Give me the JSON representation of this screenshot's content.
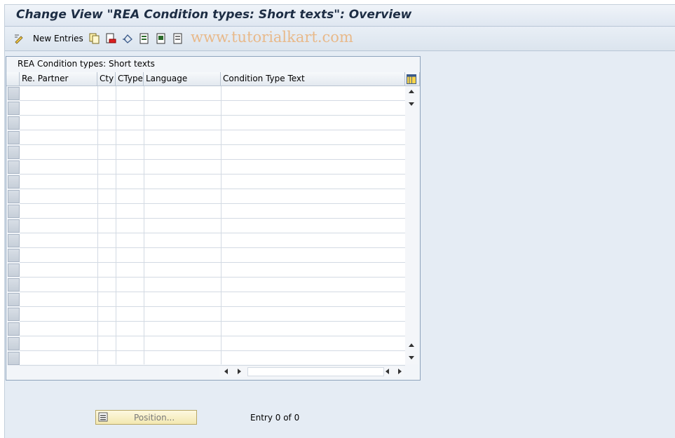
{
  "window": {
    "title": "Change View \"REA Condition types: Short texts\": Overview"
  },
  "toolbar": {
    "new_entries_label": "New Entries",
    "icons": [
      "edit-pencil-icon",
      "copy-icon",
      "delete-icon",
      "undo-icon",
      "select-all-icon",
      "select-block-icon",
      "deselect-all-icon"
    ],
    "watermark": "www.tutorialkart.com"
  },
  "table": {
    "caption": "REA Condition types: Short texts",
    "columns": [
      "Re. Partner",
      "Cty",
      "CType",
      "Language",
      "Condition Type Text"
    ],
    "rows": 19
  },
  "footer": {
    "position_button": "Position...",
    "entry_text": "Entry 0 of 0"
  },
  "colors": {
    "background": "#e5ecf4",
    "title_text": "#1d2d44",
    "watermark": "#e8b98a"
  }
}
